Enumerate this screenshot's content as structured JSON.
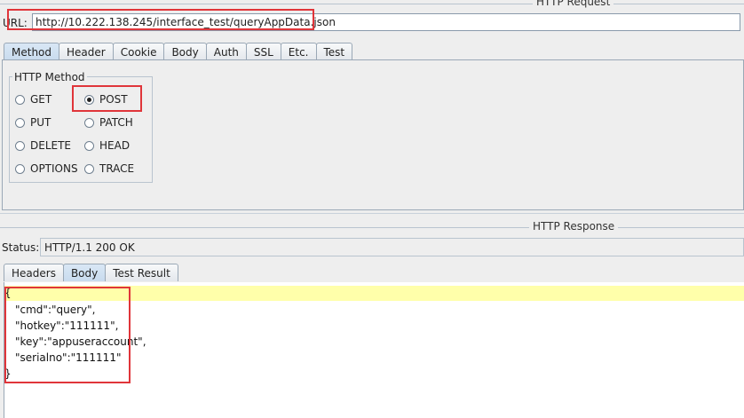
{
  "request": {
    "section_title": "HTTP Request",
    "url_label": "URL:",
    "url_value": "http://10.222.138.245/interface_test/queryAppData.json",
    "tabs": [
      "Method",
      "Header",
      "Cookie",
      "Body",
      "Auth",
      "SSL",
      "Etc.",
      "Test"
    ],
    "active_tab": "Method",
    "method_group_title": "HTTP Method",
    "methods": {
      "get": "GET",
      "post": "POST",
      "put": "PUT",
      "patch": "PATCH",
      "delete": "DELETE",
      "head": "HEAD",
      "options": "OPTIONS",
      "trace": "TRACE"
    },
    "selected_method": "POST"
  },
  "response": {
    "section_title": "HTTP Response",
    "status_label": "Status:",
    "status_value": "HTTP/1.1 200 OK",
    "tabs": [
      "Headers",
      "Body",
      "Test Result"
    ],
    "active_tab": "Body",
    "body_lines": [
      "{",
      "\"cmd\":\"query\",",
      "\"hotkey\":\"111111\",",
      "\"key\":\"appuseraccount\",",
      "\"serialno\":\"111111\"",
      "}"
    ]
  },
  "colors": {
    "annotation_box": "#e0353a",
    "highlight_line": "#ffffaa",
    "active_tab": "#c8dbee"
  }
}
